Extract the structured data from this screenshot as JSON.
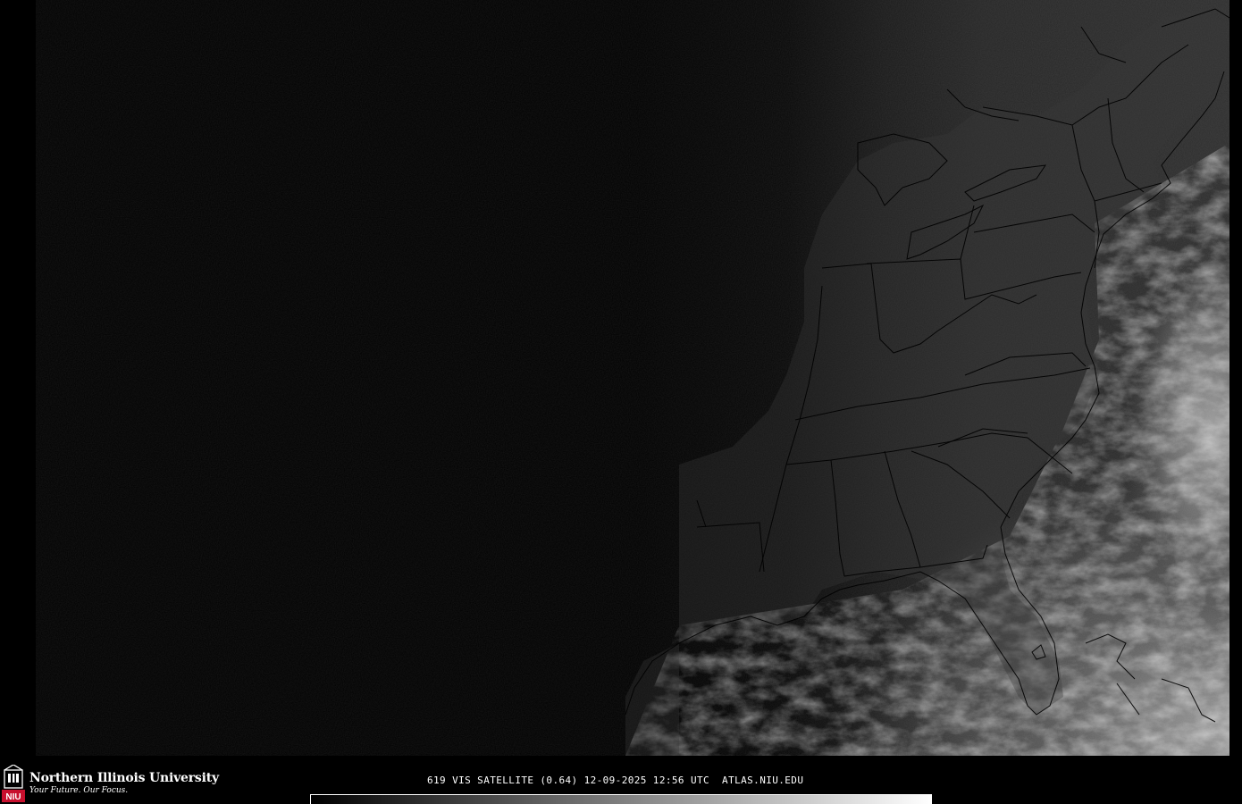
{
  "branding": {
    "university_name": "Northern Illinois University",
    "tagline": "Your Future. Our Focus.",
    "logo_text": "NIU",
    "brand_color": "#c8102e"
  },
  "caption": {
    "text": "619 VIS SATELLITE (0.64) 12-09-2025 12:56 UTC  ATLAS.NIU.EDU"
  },
  "colorbar": {
    "from_color": "#000000",
    "to_color": "#ffffff"
  },
  "map": {
    "product": "visible satellite",
    "region": "eastern United States",
    "boundary_color": "#000000",
    "night_color": "#000000",
    "land_color": "#2a2a2a",
    "cloud_color": "#d8d8d8"
  }
}
